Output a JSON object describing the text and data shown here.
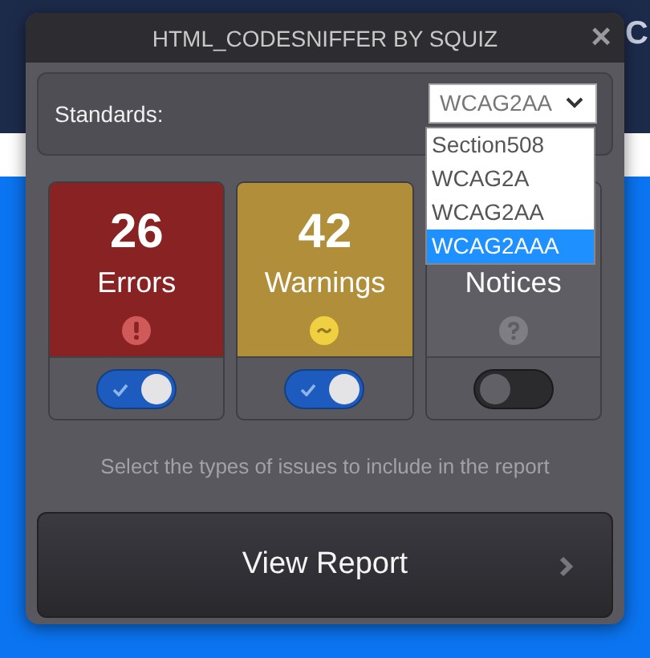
{
  "background": {
    "text": "C"
  },
  "window": {
    "title": "HTML_CODESNIFFER BY SQUIZ",
    "close": "×"
  },
  "standards": {
    "label": "Standards:",
    "value": "WCAG2AA",
    "options": [
      {
        "label": "Section508",
        "highlighted": false
      },
      {
        "label": "WCAG2A",
        "highlighted": false
      },
      {
        "label": "WCAG2AA",
        "highlighted": false
      },
      {
        "label": "WCAG2AAA",
        "highlighted": true
      }
    ]
  },
  "issue_types": [
    {
      "kind": "errors",
      "count": "26",
      "label": "Errors",
      "on": true
    },
    {
      "kind": "warnings",
      "count": "42",
      "label": "Warnings",
      "on": true
    },
    {
      "kind": "notices",
      "label": "Notices",
      "on": false
    }
  ],
  "hint": "Select the types of issues to include in the report",
  "report_button": {
    "label": "View Report"
  }
}
